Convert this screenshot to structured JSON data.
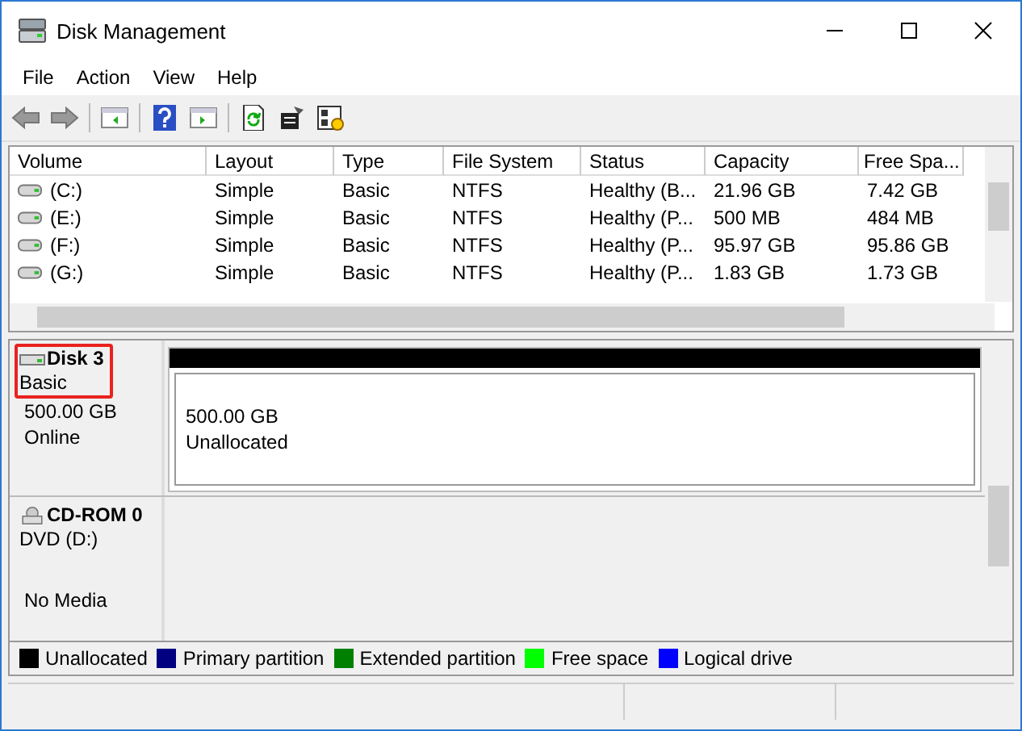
{
  "window": {
    "title": "Disk Management"
  },
  "menu": [
    "File",
    "Action",
    "View",
    "Help"
  ],
  "table": {
    "columns": [
      "Volume",
      "Layout",
      "Type",
      "File System",
      "Status",
      "Capacity",
      "Free Spa..."
    ],
    "rows": [
      [
        "(C:)",
        "Simple",
        "Basic",
        "NTFS",
        "Healthy (B...",
        "21.96 GB",
        "7.42 GB"
      ],
      [
        "(E:)",
        "Simple",
        "Basic",
        "NTFS",
        "Healthy (P...",
        "500 MB",
        "484 MB"
      ],
      [
        "(F:)",
        "Simple",
        "Basic",
        "NTFS",
        "Healthy (P...",
        "95.97 GB",
        "95.86 GB"
      ],
      [
        "(G:)",
        "Simple",
        "Basic",
        "NTFS",
        "Healthy (P...",
        "1.83 GB",
        "1.73 GB"
      ]
    ]
  },
  "disks": [
    {
      "kind": "disk",
      "name": "Disk 3",
      "highlighted": true,
      "lines": [
        "Basic",
        "500.00 GB",
        "Online"
      ],
      "partitions": [
        {
          "size": "500.00 GB",
          "label": "Unallocated",
          "color": "#000000"
        }
      ]
    },
    {
      "kind": "cdrom",
      "name": "CD-ROM 0",
      "highlighted": false,
      "lines": [
        "DVD (D:)"
      ],
      "note": "No Media"
    }
  ],
  "legend": [
    {
      "label": "Unallocated",
      "color": "#000000"
    },
    {
      "label": "Primary partition",
      "color": "#000080"
    },
    {
      "label": "Extended partition",
      "color": "#008000"
    },
    {
      "label": "Free space",
      "color": "#00ff00"
    },
    {
      "label": "Logical drive",
      "color": "#0000ff"
    }
  ]
}
